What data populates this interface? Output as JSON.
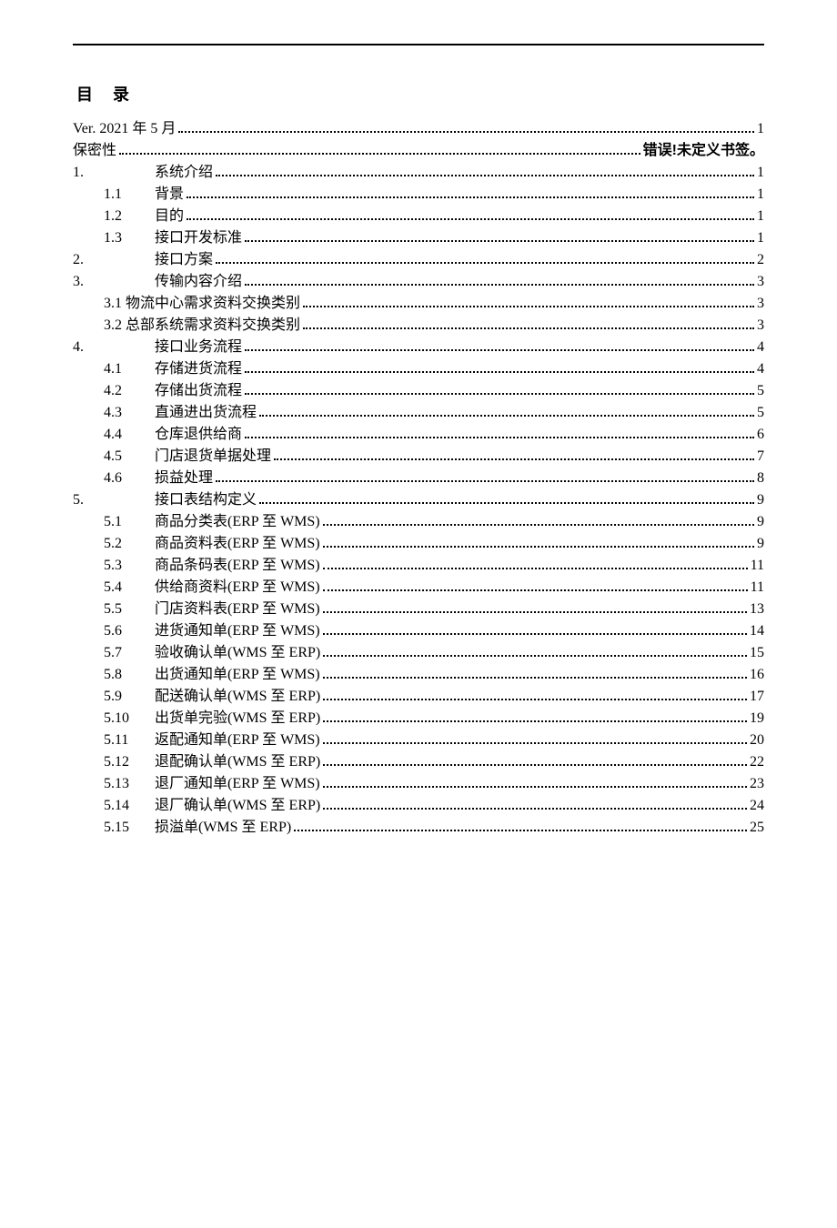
{
  "title": "目录",
  "error_text": "错误!未定义书签。",
  "entries": [
    {
      "a": "",
      "b": "",
      "label": "Ver. 2021 年 5 月",
      "pg": "1"
    },
    {
      "a": "",
      "b": "",
      "label": "保密性",
      "pg": "ERR"
    },
    {
      "a": "1.",
      "b": "",
      "label": "系统介绍",
      "pg": "1"
    },
    {
      "a": "",
      "b": "1.1",
      "label": "背景",
      "pg": "1"
    },
    {
      "a": "",
      "b": "1.2",
      "label": "目的",
      "pg": "1"
    },
    {
      "a": "",
      "b": "1.3",
      "label": "接口开发标准",
      "pg": "1"
    },
    {
      "a": "2.",
      "b": "",
      "label": "接口方案",
      "pg": "2"
    },
    {
      "a": "3.",
      "b": "",
      "label": "传输内容介绍",
      "pg": "3"
    },
    {
      "a": "",
      "b": "",
      "label": "3.1 物流中心需求资料交换类别",
      "pg": "3"
    },
    {
      "a": "",
      "b": "",
      "label": "3.2 总部系统需求资料交换类别",
      "pg": "3"
    },
    {
      "a": "4.",
      "b": "",
      "label": "接口业务流程",
      "pg": "4"
    },
    {
      "a": "",
      "b": "4.1",
      "label": "存储进货流程",
      "pg": "4"
    },
    {
      "a": "",
      "b": "4.2",
      "label": "存储出货流程",
      "pg": "5"
    },
    {
      "a": "",
      "b": "4.3",
      "label": "直通进出货流程",
      "pg": "5"
    },
    {
      "a": "",
      "b": "4.4",
      "label": "仓库退供给商",
      "pg": "6"
    },
    {
      "a": "",
      "b": "4.5",
      "label": "门店退货单据处理",
      "pg": "7"
    },
    {
      "a": "",
      "b": "4.6",
      "label": "损益处理",
      "pg": "8"
    },
    {
      "a": "5.",
      "b": "",
      "label": "接口表结构定义",
      "pg": "9"
    },
    {
      "a": "",
      "b": "5.1",
      "label": "商品分类表(ERP 至 WMS)",
      "pg": "9"
    },
    {
      "a": "",
      "b": "5.2",
      "label": "商品资料表(ERP 至 WMS)",
      "pg": "9"
    },
    {
      "a": "",
      "b": "5.3",
      "label": "商品条码表(ERP 至 WMS)",
      "pg": "11"
    },
    {
      "a": "",
      "b": "5.4",
      "label": "供给商资料(ERP 至 WMS)",
      "pg": "11"
    },
    {
      "a": "",
      "b": "5.5",
      "label": "门店资料表(ERP 至 WMS)",
      "pg": "13"
    },
    {
      "a": "",
      "b": "5.6",
      "label": "进货通知单(ERP 至 WMS)",
      "pg": "14"
    },
    {
      "a": "",
      "b": "5.7",
      "label": "验收确认单(WMS 至 ERP)",
      "pg": "15"
    },
    {
      "a": "",
      "b": "5.8",
      "label": "出货通知单(ERP 至 WMS)",
      "pg": "16"
    },
    {
      "a": "",
      "b": "5.9",
      "label": "配送确认单(WMS 至 ERP)",
      "pg": "17"
    },
    {
      "a": "",
      "b": "5.10",
      "label": "出货单完验(WMS 至 ERP)",
      "pg": "19"
    },
    {
      "a": "",
      "b": "5.11",
      "label": "返配通知单(ERP 至 WMS)",
      "pg": "20"
    },
    {
      "a": "",
      "b": "5.12",
      "label": "退配确认单(WMS 至 ERP)",
      "pg": "22"
    },
    {
      "a": "",
      "b": "5.13",
      "label": "退厂通知单(ERP 至 WMS)",
      "pg": "23"
    },
    {
      "a": "",
      "b": "5.14",
      "label": "退厂确认单(WMS 至 ERP)",
      "pg": "24"
    },
    {
      "a": "",
      "b": "5.15",
      "label": "损溢单(WMS 至 ERP)",
      "pg": "25"
    }
  ]
}
